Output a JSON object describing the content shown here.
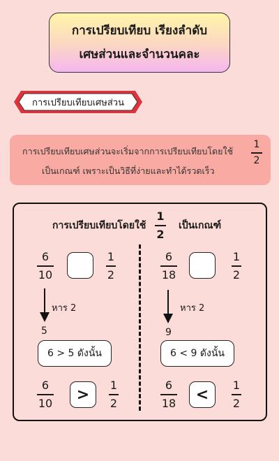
{
  "title": {
    "line1": "การเปรียบเทียบ เรียงลำดับ",
    "line2": "เศษส่วนและจำนวนคละ"
  },
  "ribbon": {
    "label": "การเปรียบเทียบเศษส่วน"
  },
  "info": {
    "line1": "การเปรียบเทียบเศษส่วนจะเริ่มจากการเปรียบเทียบโดยใช้",
    "line2": "เป็นเกณฑ์ เพราะเป็นวิธีที่ง่ายและทำได้รวดเร็ว",
    "fraction": {
      "num": "1",
      "den": "2"
    }
  },
  "example": {
    "header_before": "การเปรียบเทียบโดยใช้",
    "header_after": "เป็นเกณฑ์",
    "header_fraction": {
      "num": "1",
      "den": "2"
    },
    "left": {
      "fraction": {
        "num": "6",
        "den": "10"
      },
      "benchmark": {
        "num": "1",
        "den": "2"
      },
      "divide_label": "หาร 2",
      "quotient": "5",
      "comparison": "6  >  5 ดังนั้น",
      "result_symbol": ">"
    },
    "right": {
      "fraction": {
        "num": "6",
        "den": "18"
      },
      "benchmark": {
        "num": "1",
        "den": "2"
      },
      "divide_label": "หาร 2",
      "quotient": "9",
      "comparison": "6  <  9 ดังนั้น",
      "result_symbol": "<"
    }
  },
  "colors": {
    "background": "#fcdcd8",
    "info_box": "#f8aaa3",
    "ribbon_accent": "#e0323c"
  }
}
